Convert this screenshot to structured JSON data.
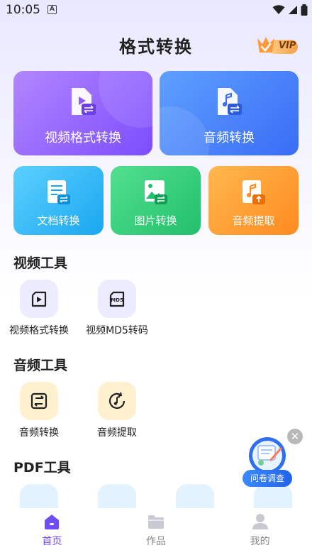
{
  "status_bar": {
    "time": "10:05",
    "a_glyph": "A"
  },
  "header": {
    "title": "格式转换",
    "vip_label": "VIP"
  },
  "cards": {
    "video_convert": "视频格式转换",
    "audio_convert": "音频转换",
    "doc_convert": "文档转换",
    "image_convert": "图片转换",
    "audio_extract": "音频提取"
  },
  "sections": {
    "video_tools": {
      "title": "视频工具",
      "items": [
        {
          "label": "视频格式转换",
          "icon": "video-play-icon"
        },
        {
          "label": "视频MD5转码",
          "icon": "md5-icon"
        }
      ]
    },
    "audio_tools": {
      "title": "音频工具",
      "items": [
        {
          "label": "音频转换",
          "icon": "audio-swap-icon"
        },
        {
          "label": "音频提取",
          "icon": "audio-extract-icon"
        }
      ]
    },
    "pdf_tools": {
      "title": "PDF工具"
    }
  },
  "survey": {
    "label": "问卷调查"
  },
  "nav": [
    {
      "label": "首页",
      "icon": "home-icon",
      "active": true
    },
    {
      "label": "作品",
      "icon": "folder-icon",
      "active": false
    },
    {
      "label": "我的",
      "icon": "user-icon",
      "active": false
    }
  ],
  "colors": {
    "accent": "#6f4cf6",
    "video_card": "#8a5cff",
    "audio_card": "#4a82fa",
    "doc_card": "#2bb4f4",
    "image_card": "#2fcd78",
    "extract_card": "#ff9a2c"
  }
}
